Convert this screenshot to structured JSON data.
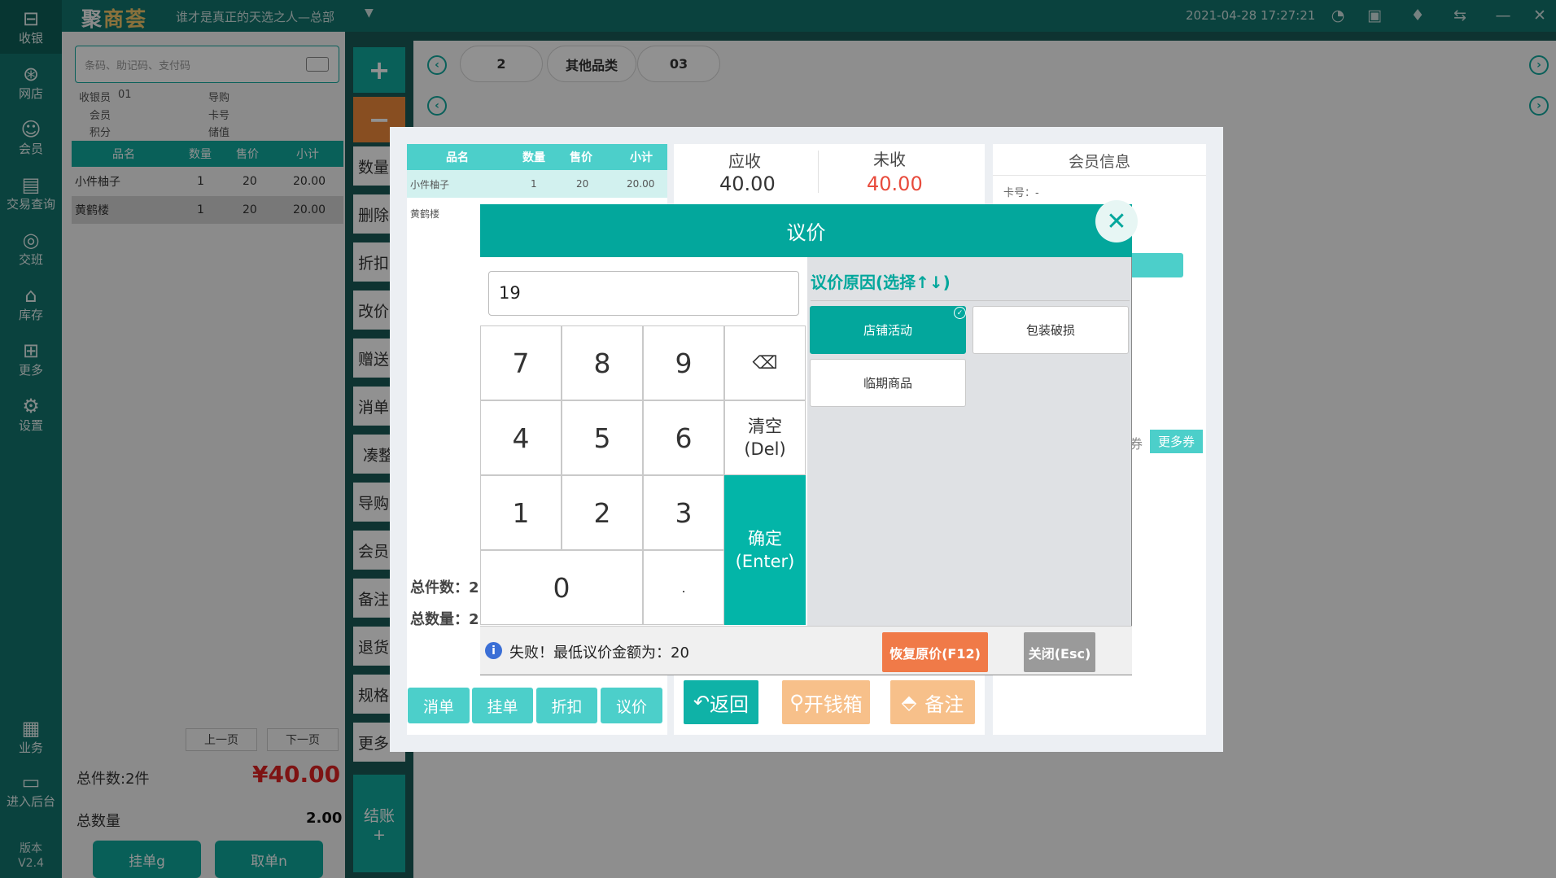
{
  "topbar": {
    "logo_main": "聚",
    "logo_em": "商荟",
    "shop": "谁才是真正的天选之人—总部",
    "datetime": "2021-04-28 17:27:21"
  },
  "nav": {
    "items": [
      {
        "label": "收银",
        "icon": "cashier-icon"
      },
      {
        "label": "网店",
        "icon": "scooter-icon"
      },
      {
        "label": "会员",
        "icon": "user-icon"
      },
      {
        "label": "交易查询",
        "icon": "document-icon"
      },
      {
        "label": "交班",
        "icon": "shift-icon"
      },
      {
        "label": "库存",
        "icon": "warehouse-icon"
      },
      {
        "label": "更多",
        "icon": "grid-icon"
      },
      {
        "label": "设置",
        "icon": "gear-icon"
      },
      {
        "label": "业务",
        "icon": "clipboard-icon"
      },
      {
        "label": "进入后台",
        "icon": "monitor-icon"
      }
    ],
    "version_label": "版本",
    "version": "V2.4"
  },
  "cart": {
    "search_placeholder": "条码、助记码、支付码",
    "cashier_label": "收银员",
    "cashier_value": "01",
    "guide_label": "导购",
    "member_label": "会员",
    "card_label": "卡号",
    "points_label": "积分",
    "stored_label": "储值",
    "columns": [
      "品名",
      "数量",
      "售价",
      "小计"
    ],
    "rows": [
      {
        "name": "小件柚子",
        "qty": "1",
        "price": "20",
        "subtotal": "20.00"
      },
      {
        "name": "黄鹤楼",
        "qty": "1",
        "price": "20",
        "subtotal": "20.00"
      }
    ],
    "prev_page": "上一页",
    "next_page": "下一页",
    "total_items": "总件数:2件",
    "total_amount": "¥40.00",
    "total_qty_label": "总数量",
    "total_qty": "2.00",
    "hang_btn": "挂单g",
    "take_btn": "取单n"
  },
  "actions": {
    "plus": "+",
    "minus": "−",
    "items": [
      "数量",
      "删除",
      "折扣",
      "改价",
      "赠送",
      "消单",
      "凑整",
      "导购",
      "会员",
      "备注",
      "退货",
      "规格",
      "更多"
    ],
    "pay": "结账",
    "pay_sub": "+"
  },
  "categories": {
    "pills": [
      "2",
      "其他品类",
      "03"
    ]
  },
  "settle": {
    "columns": [
      "品名",
      "数量",
      "售价",
      "小计"
    ],
    "rows": [
      {
        "name": "小件柚子",
        "qty": "1",
        "price": "20",
        "subtotal": "20.00"
      },
      {
        "name": "黄鹤楼",
        "qty": "",
        "price": "",
        "subtotal": ""
      }
    ],
    "receivable_label": "应收",
    "receivable": "40.00",
    "unpaid_label": "未收",
    "unpaid": "40.00",
    "member_title": "会员信息",
    "card_line": "卡号：-",
    "coupon_tail": "券",
    "more_coupons": "更多券",
    "total_items": "总件数：2",
    "total_qty": "总数量：2",
    "small_buttons": [
      "消单",
      "挂单",
      "折扣",
      "议价"
    ],
    "back": "返回",
    "open_drawer": "开钱箱",
    "note": "备注"
  },
  "modal": {
    "title": "议价",
    "input_value": "19",
    "keys": [
      "7",
      "8",
      "9",
      "4",
      "5",
      "6",
      "1",
      "2",
      "3",
      "0",
      "."
    ],
    "clear": "清空",
    "clear_key": "(Del)",
    "confirm": "确定",
    "confirm_key": "(Enter)",
    "reason_title": "议价原因(选择↑↓)",
    "reasons": [
      "店铺活动",
      "包装破损",
      "临期商品"
    ],
    "message": "失败！最低议价金额为：20",
    "restore": "恢复原价(F12)",
    "close": "关闭(Esc)"
  }
}
